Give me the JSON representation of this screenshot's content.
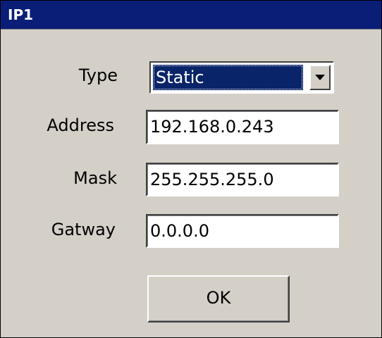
{
  "window": {
    "title": "IP1"
  },
  "form": {
    "type": {
      "label": "Type",
      "value": "Static"
    },
    "address": {
      "label": "Address",
      "value": "192.168.0.243"
    },
    "mask": {
      "label": "Mask",
      "value": "255.255.255.0"
    },
    "gatway": {
      "label": "Gatway",
      "value": "0.0.0.0"
    }
  },
  "buttons": {
    "ok_label": "OK"
  },
  "icons": {
    "combo_arrow": "chevron-down-icon"
  },
  "colors": {
    "titlebar": "#0a1e78",
    "title_text": "#ffffff",
    "window_bg": "#d4d0c8",
    "selection_bg": "#0a246a",
    "field_bg": "#ffffff"
  }
}
